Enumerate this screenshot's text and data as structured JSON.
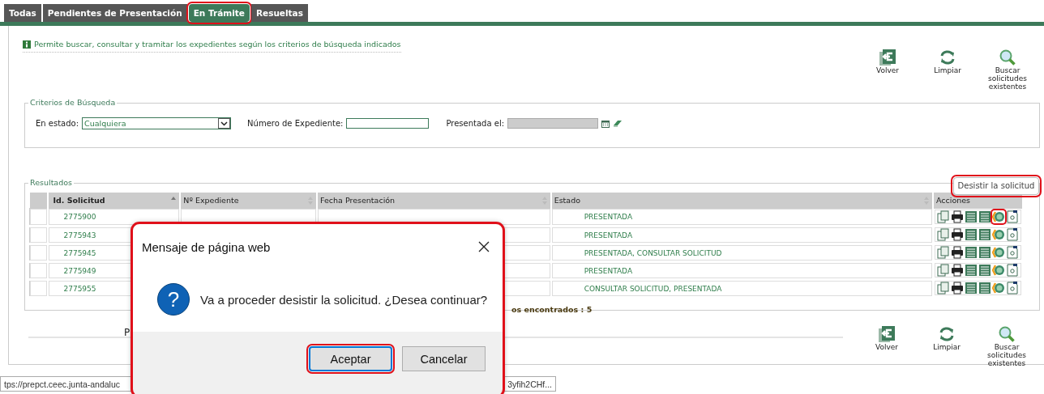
{
  "tabs": [
    {
      "label": "Todas",
      "selected": false,
      "highlighted": false
    },
    {
      "label": "Pendientes de Presentación",
      "selected": false,
      "highlighted": false
    },
    {
      "label": "En Trámite",
      "selected": true,
      "highlighted": true
    },
    {
      "label": "Resueltas",
      "selected": false,
      "highlighted": false
    }
  ],
  "info": "Permite buscar, consultar y tramitar los expedientes según los criterios de búsqueda indicados",
  "toolbar_top": [
    {
      "kind": "back",
      "label": "Volver"
    },
    {
      "kind": "clear",
      "label": "Limpiar"
    },
    {
      "kind": "search",
      "label": "Buscar solicitudes existentes"
    }
  ],
  "criteria": {
    "legend": "Criterios de Búsqueda",
    "estado_label": "En estado:",
    "estado_value": "Cualquiera",
    "expediente_label": "Número de Expediente:",
    "presentada_label": "Presentada el:",
    "presentada_disabled": true
  },
  "results": {
    "legend": "Resultados",
    "columns": [
      {
        "label": "Id. Solicitud",
        "sorted": true
      },
      {
        "label": "Nº Expediente",
        "sorted": false
      },
      {
        "label": "Fecha Presentación",
        "sorted": false
      },
      {
        "label": "Estado",
        "sorted": false
      },
      {
        "label": "Acciones",
        "sorted": false
      }
    ],
    "rows": [
      {
        "id": "2775900",
        "estado": "PRESENTADA",
        "desist_highlighted": true
      },
      {
        "id": "2775943",
        "estado": "PRESENTADA",
        "desist_highlighted": false
      },
      {
        "id": "2775945",
        "estado": "PRESENTADA, CONSULTAR SOLICITUD",
        "desist_highlighted": false
      },
      {
        "id": "2775949",
        "estado": "PRESENTADA",
        "desist_highlighted": false
      },
      {
        "id": "2775955",
        "estado": "CONSULTAR SOLICITUD, PRESENTADA",
        "desist_highlighted": false
      }
    ],
    "count": "os encontrados : 5"
  },
  "tooltip": {
    "text": "Desistir la solicitud",
    "highlighted": true
  },
  "bottom_label": "P",
  "toolbar_bottom": [
    {
      "kind": "back",
      "label": "Volver"
    },
    {
      "kind": "clear",
      "label": "Limpiar"
    },
    {
      "kind": "search",
      "label": "Buscar solicitudes existentes"
    }
  ],
  "status_bar": {
    "start": "tps://prepct.ceec.junta-andaluc",
    "end": "3yfih2CHf..."
  },
  "dialog": {
    "title": "Mensaje de página web",
    "icon": "?",
    "message": "Va a proceder desistir la solicitud. ¿Desea continuar?",
    "highlighted": true,
    "buttons": [
      {
        "label": "Aceptar",
        "default": true,
        "highlighted": true
      },
      {
        "label": "Cancelar",
        "default": false,
        "highlighted": false
      }
    ]
  }
}
